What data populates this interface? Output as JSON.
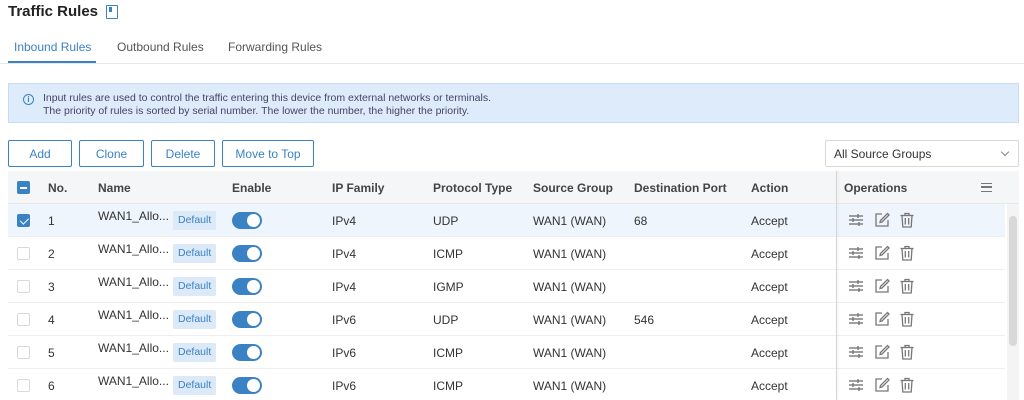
{
  "page": {
    "title": "Traffic Rules",
    "bookmark_icon": "bookmark-icon"
  },
  "tabs": [
    {
      "label": "Inbound Rules",
      "active": true
    },
    {
      "label": "Outbound Rules",
      "active": false
    },
    {
      "label": "Forwarding Rules",
      "active": false
    }
  ],
  "info": {
    "line1": "Input rules are used to control the traffic entering this device from external networks or terminals.",
    "line2": "The priority of rules is sorted by serial number. The lower the number, the higher the priority.",
    "icon": "info-icon"
  },
  "toolbar": {
    "add": "Add",
    "clone": "Clone",
    "delete": "Delete",
    "move_top": "Move to Top"
  },
  "filter": {
    "selected": "All Source Groups"
  },
  "columns": {
    "no": "No.",
    "name": "Name",
    "enable": "Enable",
    "ip_family": "IP Family",
    "protocol": "Protocol Type",
    "source_group": "Source Group",
    "dest_port": "Destination Port",
    "action": "Action",
    "operations": "Operations"
  },
  "rows": [
    {
      "no": "1",
      "name": "WAN1_Allo...",
      "badge": "Default",
      "enabled": true,
      "ip_family": "IPv4",
      "protocol": "UDP",
      "source_group": "WAN1 (WAN)",
      "dest_port": "68",
      "action": "Accept",
      "checked": true
    },
    {
      "no": "2",
      "name": "WAN1_Allo...",
      "badge": "Default",
      "enabled": true,
      "ip_family": "IPv4",
      "protocol": "ICMP",
      "source_group": "WAN1 (WAN)",
      "dest_port": "",
      "action": "Accept",
      "checked": false
    },
    {
      "no": "3",
      "name": "WAN1_Allo...",
      "badge": "Default",
      "enabled": true,
      "ip_family": "IPv4",
      "protocol": "IGMP",
      "source_group": "WAN1 (WAN)",
      "dest_port": "",
      "action": "Accept",
      "checked": false
    },
    {
      "no": "4",
      "name": "WAN1_Allo...",
      "badge": "Default",
      "enabled": true,
      "ip_family": "IPv6",
      "protocol": "UDP",
      "source_group": "WAN1 (WAN)",
      "dest_port": "546",
      "action": "Accept",
      "checked": false
    },
    {
      "no": "5",
      "name": "WAN1_Allo...",
      "badge": "Default",
      "enabled": true,
      "ip_family": "IPv6",
      "protocol": "ICMP",
      "source_group": "WAN1 (WAN)",
      "dest_port": "",
      "action": "Accept",
      "checked": false
    },
    {
      "no": "6",
      "name": "WAN1_Allo...",
      "badge": "Default",
      "enabled": true,
      "ip_family": "IPv6",
      "protocol": "ICMP",
      "source_group": "WAN1 (WAN)",
      "dest_port": "",
      "action": "Accept",
      "checked": false
    }
  ],
  "colors": {
    "accent": "#3b82c4",
    "info_bg": "#deebfa",
    "badge_bg": "#dce9f8"
  }
}
